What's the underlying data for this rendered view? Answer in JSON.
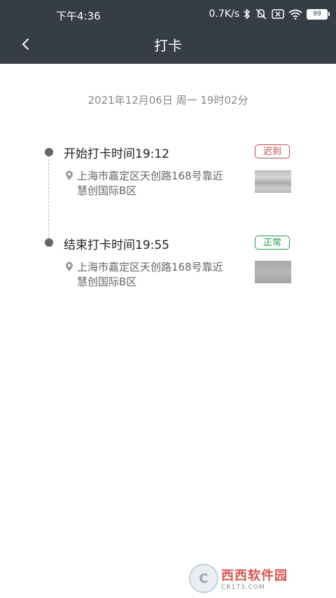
{
  "status_bar": {
    "time": "下午4:36",
    "speed": "0.7K/s",
    "battery": "99"
  },
  "header": {
    "title": "打卡"
  },
  "date_line": "2021年12月06日 周一 19时02分",
  "records": [
    {
      "title": "开始打卡时间19:12",
      "status": "迟到",
      "address": "上海市嘉定区天创路168号靠近慧创国际B区"
    },
    {
      "title": "结束打卡时间19:55",
      "status": "正常",
      "address": "上海市嘉定区天创路168号靠近慧创国际B区"
    }
  ],
  "watermark": {
    "main": "西西软件园",
    "sub": "CR173.COM"
  },
  "colors": {
    "header_bg": "#363d47",
    "late": "#c0504d",
    "normal": "#2e9a4a"
  }
}
